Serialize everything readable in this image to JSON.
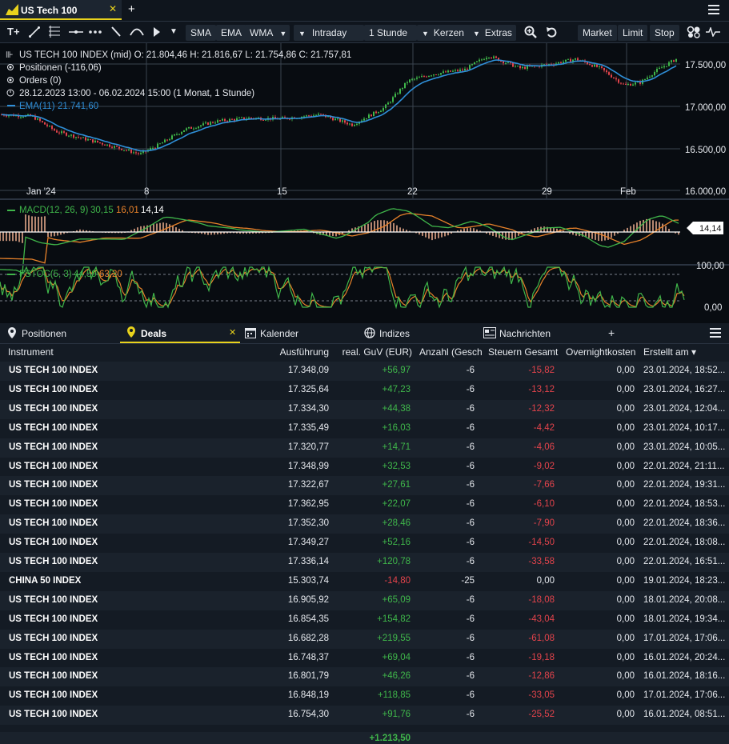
{
  "window": {
    "tab_title": "US Tech 100",
    "tab_close": "✕",
    "tab_add": "+"
  },
  "toolbar": {
    "text_tool": "T+",
    "sma": "SMA",
    "ema": "EMA",
    "wma": "WMA",
    "interval": "Intraday",
    "period": "1 Stunde",
    "chart_type": "Kerzen",
    "extras": "Extras",
    "market": "Market",
    "limit": "Limit",
    "stop": "Stop"
  },
  "chart": {
    "header_line": "US TECH 100 INDEX (mid)  O: 21.804,46  H: 21.816,67  L: 21.754,86  C: 21.757,81",
    "positions_line": "Positionen (-116,06)",
    "orders_line": "Orders (0)",
    "range_line": "28.12.2023 13:00 - 06.02.2024 15:00  (1 Monat, 1 Stunde)",
    "ema_label": "EMA(11)",
    "ema_value": "21.741,60",
    "price_axis": [
      "17.500,00",
      "17.000,00",
      "16.500,00",
      "16.000,00"
    ],
    "time_axis": [
      "Jan '24",
      "8",
      "15",
      "22",
      "29",
      "Feb"
    ],
    "macd_label": "MACD(12, 26, 9)",
    "macd_v1": "30,15",
    "macd_v2": "16,01",
    "macd_v3": "14,14",
    "macd_badge": "14,14",
    "fstoc_label": "FSTOC(5, 3)",
    "fstoc_v1": "44,59",
    "fstoc_v2": "63,20",
    "fstoc_axis_top": "100,00",
    "fstoc_axis_bottom": "0,00",
    "colors": {
      "candle_up": "#3fb64a",
      "candle_down": "#e2434b",
      "ema": "#2f8fd8",
      "macd_line": "#3fb64a",
      "signal_line": "#e8822a",
      "histogram": "#f0b090",
      "fstoc_k": "#3fb64a",
      "fstoc_d": "#e8822a"
    }
  },
  "panel": {
    "tabs": [
      "Positionen",
      "Deals",
      "Kalender",
      "Indizes",
      "Nachrichten"
    ],
    "deals_close": "✕",
    "add_tab": "+"
  },
  "table": {
    "headers": {
      "instrument": "Instrument",
      "ausfuehrung": "Ausführung",
      "guv": "real. GuV (EUR)",
      "anzahl": "Anzahl (Geschl",
      "steuern": "Steuern Gesamt",
      "overnight": "Overnightkosten",
      "erstellt": "Erstellt am ▾"
    },
    "rows": [
      {
        "instrument": "US TECH 100 INDEX",
        "ausfuehrung": "17.348,09",
        "guv": "+56,97",
        "anzahl": "-6",
        "steuern": "-15,82",
        "overnight": "0,00",
        "erstellt": "23.01.2024, 18:52..."
      },
      {
        "instrument": "US TECH 100 INDEX",
        "ausfuehrung": "17.325,64",
        "guv": "+47,23",
        "anzahl": "-6",
        "steuern": "-13,12",
        "overnight": "0,00",
        "erstellt": "23.01.2024, 16:27..."
      },
      {
        "instrument": "US TECH 100 INDEX",
        "ausfuehrung": "17.334,30",
        "guv": "+44,38",
        "anzahl": "-6",
        "steuern": "-12,32",
        "overnight": "0,00",
        "erstellt": "23.01.2024, 12:04..."
      },
      {
        "instrument": "US TECH 100 INDEX",
        "ausfuehrung": "17.335,49",
        "guv": "+16,03",
        "anzahl": "-6",
        "steuern": "-4,42",
        "overnight": "0,00",
        "erstellt": "23.01.2024, 10:17..."
      },
      {
        "instrument": "US TECH 100 INDEX",
        "ausfuehrung": "17.320,77",
        "guv": "+14,71",
        "anzahl": "-6",
        "steuern": "-4,06",
        "overnight": "0,00",
        "erstellt": "23.01.2024, 10:05..."
      },
      {
        "instrument": "US TECH 100 INDEX",
        "ausfuehrung": "17.348,99",
        "guv": "+32,53",
        "anzahl": "-6",
        "steuern": "-9,02",
        "overnight": "0,00",
        "erstellt": "22.01.2024, 21:11..."
      },
      {
        "instrument": "US TECH 100 INDEX",
        "ausfuehrung": "17.322,67",
        "guv": "+27,61",
        "anzahl": "-6",
        "steuern": "-7,66",
        "overnight": "0,00",
        "erstellt": "22.01.2024, 19:31..."
      },
      {
        "instrument": "US TECH 100 INDEX",
        "ausfuehrung": "17.362,95",
        "guv": "+22,07",
        "anzahl": "-6",
        "steuern": "-6,10",
        "overnight": "0,00",
        "erstellt": "22.01.2024, 18:53..."
      },
      {
        "instrument": "US TECH 100 INDEX",
        "ausfuehrung": "17.352,30",
        "guv": "+28,46",
        "anzahl": "-6",
        "steuern": "-7,90",
        "overnight": "0,00",
        "erstellt": "22.01.2024, 18:36..."
      },
      {
        "instrument": "US TECH 100 INDEX",
        "ausfuehrung": "17.349,27",
        "guv": "+52,16",
        "anzahl": "-6",
        "steuern": "-14,50",
        "overnight": "0,00",
        "erstellt": "22.01.2024, 18:08..."
      },
      {
        "instrument": "US TECH 100 INDEX",
        "ausfuehrung": "17.336,14",
        "guv": "+120,78",
        "anzahl": "-6",
        "steuern": "-33,58",
        "overnight": "0,00",
        "erstellt": "22.01.2024, 16:51..."
      },
      {
        "instrument": "CHINA 50 INDEX",
        "ausfuehrung": "15.303,74",
        "guv": "-14,80",
        "anzahl": "-25",
        "steuern": "0,00",
        "overnight": "0,00",
        "erstellt": "19.01.2024, 18:23..."
      },
      {
        "instrument": "US TECH 100 INDEX",
        "ausfuehrung": "16.905,92",
        "guv": "+65,09",
        "anzahl": "-6",
        "steuern": "-18,08",
        "overnight": "0,00",
        "erstellt": "18.01.2024, 20:08..."
      },
      {
        "instrument": "US TECH 100 INDEX",
        "ausfuehrung": "16.854,35",
        "guv": "+154,82",
        "anzahl": "-6",
        "steuern": "-43,04",
        "overnight": "0,00",
        "erstellt": "18.01.2024, 19:34..."
      },
      {
        "instrument": "US TECH 100 INDEX",
        "ausfuehrung": "16.682,28",
        "guv": "+219,55",
        "anzahl": "-6",
        "steuern": "-61,08",
        "overnight": "0,00",
        "erstellt": "17.01.2024, 17:06..."
      },
      {
        "instrument": "US TECH 100 INDEX",
        "ausfuehrung": "16.748,37",
        "guv": "+69,04",
        "anzahl": "-6",
        "steuern": "-19,18",
        "overnight": "0,00",
        "erstellt": "16.01.2024, 20:24..."
      },
      {
        "instrument": "US TECH 100 INDEX",
        "ausfuehrung": "16.801,79",
        "guv": "+46,26",
        "anzahl": "-6",
        "steuern": "-12,86",
        "overnight": "0,00",
        "erstellt": "16.01.2024, 18:16..."
      },
      {
        "instrument": "US TECH 100 INDEX",
        "ausfuehrung": "16.848,19",
        "guv": "+118,85",
        "anzahl": "-6",
        "steuern": "-33,05",
        "overnight": "0,00",
        "erstellt": "17.01.2024, 17:06..."
      },
      {
        "instrument": "US TECH 100 INDEX",
        "ausfuehrung": "16.754,30",
        "guv": "+91,76",
        "anzahl": "-6",
        "steuern": "-25,52",
        "overnight": "0,00",
        "erstellt": "16.01.2024, 08:51..."
      }
    ],
    "total_guv": "+1.213,50"
  }
}
